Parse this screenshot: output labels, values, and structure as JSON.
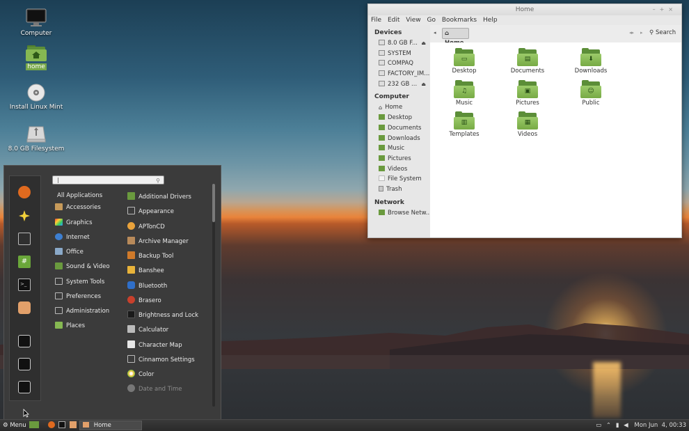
{
  "desktop": {
    "icons": [
      {
        "label": "Computer",
        "icon": "monitor-icon"
      },
      {
        "label": "home",
        "icon": "home-folder-icon"
      },
      {
        "label": "Install Linux Mint",
        "icon": "disc-icon"
      },
      {
        "label": "8.0 GB Filesystem",
        "icon": "drive-icon"
      }
    ]
  },
  "file_manager": {
    "title": "Home",
    "menubar": [
      "File",
      "Edit",
      "View",
      "Go",
      "Bookmarks",
      "Help"
    ],
    "sidebar": {
      "devices_header": "Devices",
      "devices": [
        "8.0 GB F...",
        "SYSTEM",
        "COMPAQ",
        "FACTORY_IM...",
        "232 GB ..."
      ],
      "computer_header": "Computer",
      "computer": [
        "Home",
        "Desktop",
        "Documents",
        "Downloads",
        "Music",
        "Pictures",
        "Videos",
        "File System",
        "Trash"
      ],
      "network_header": "Network",
      "network": [
        "Browse Netw..."
      ]
    },
    "toolbar": {
      "location": "Home",
      "search_label": "Search"
    },
    "folders": [
      "Desktop",
      "Documents",
      "Downloads",
      "Music",
      "Pictures",
      "Public",
      "Templates",
      "Videos"
    ]
  },
  "menu": {
    "search_value": "|",
    "categories": [
      "All Applications",
      "Accessories",
      "Graphics",
      "Internet",
      "Office",
      "Sound & Video",
      "System Tools",
      "Preferences",
      "Administration",
      "Places"
    ],
    "apps": [
      "Additional Drivers",
      "Appearance",
      "APTonCD",
      "Archive Manager",
      "Backup Tool",
      "Banshee",
      "Bluetooth",
      "Brasero",
      "Brightness and Lock",
      "Calculator",
      "Character Map",
      "Cinnamon Settings",
      "Color",
      "Date and Time"
    ]
  },
  "panel": {
    "menu_label": "Menu",
    "task_label": "Home",
    "clock": "Mon Jun  4, 00:33"
  },
  "colors": {
    "accent": "#78a84a",
    "folder": "#8fc05a",
    "menu_bg": "#3b3b3b",
    "panel_bg": "#2f2f2f"
  }
}
